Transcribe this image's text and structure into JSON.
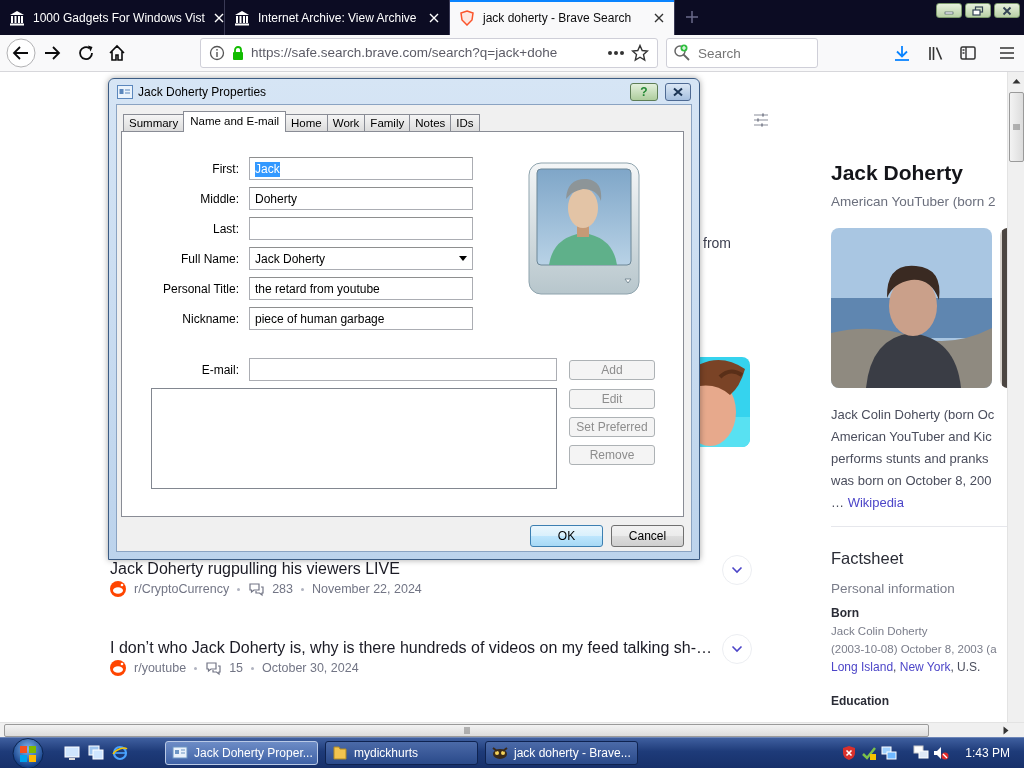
{
  "browser": {
    "tabs": [
      {
        "title": "1000 Gadgets For Windows Vist",
        "kind": "archive",
        "selected": false
      },
      {
        "title": "Internet Archive: View Archive",
        "kind": "archive",
        "selected": false
      },
      {
        "title": "jack doherty - Brave Search",
        "kind": "brave",
        "selected": true
      }
    ],
    "url": "https://safe.search.brave.com/search?q=jack+dohe",
    "search_placeholder": "Search"
  },
  "page": {
    "snippet_fragment": "from",
    "results": [
      {
        "title": "Jack Doherty rugpulling his viewers LIVE",
        "community": "r/CryptoCurrency",
        "comments": "283",
        "date": "November 22, 2024"
      },
      {
        "title": "I don’t who Jack Doherty is, why is there hundreds of videos on my feed talking sh-…",
        "community": "r/youtube",
        "comments": "15",
        "date": "October 30, 2024"
      }
    ],
    "infobox": {
      "title": "Jack Doherty",
      "subtitle": "American YouTuber (born 2",
      "description_lines": [
        "Jack Colin Doherty (born Oc",
        "American YouTuber and Kic",
        "performs stunts and pranks",
        "was born on October 8, 200"
      ],
      "ellipsis": "…",
      "source_link": "Wikipedia",
      "factsheet_title": "Factsheet",
      "section": "Personal information",
      "born_label": "Born",
      "born_lines": [
        "Jack Colin Doherty",
        "(2003-10-08) October 8, 2003 (a"
      ],
      "born_place": [
        {
          "text": "Long Island",
          "link": true
        },
        {
          "text": ", ",
          "link": false
        },
        {
          "text": "New York",
          "link": true
        },
        {
          "text": ", U.S.",
          "link": false
        }
      ],
      "education_label": "Education"
    }
  },
  "dialog": {
    "title": "Jack Doherty Properties",
    "help": "?",
    "tabs": [
      {
        "label": "Summary",
        "selected": false
      },
      {
        "label": "Name and E-mail",
        "selected": true
      },
      {
        "label": "Home",
        "selected": false
      },
      {
        "label": "Work",
        "selected": false
      },
      {
        "label": "Family",
        "selected": false
      },
      {
        "label": "Notes",
        "selected": false
      },
      {
        "label": "IDs",
        "selected": false
      }
    ],
    "fields": [
      {
        "label": "First:",
        "value": "Jack",
        "kind": "text",
        "highlighted": true
      },
      {
        "label": "Middle:",
        "value": "Doherty",
        "kind": "text",
        "highlighted": false
      },
      {
        "label": "Last:",
        "kind": "text",
        "highlighted": false
      },
      {
        "label": "Full Name:",
        "value": "Jack Doherty",
        "kind": "dropdown",
        "highlighted": false
      },
      {
        "label": "Personal Title:",
        "value": "the retard from youtube",
        "kind": "text",
        "highlighted": false
      },
      {
        "label": "Nickname:",
        "value": "piece of human garbage",
        "kind": "text",
        "highlighted": false
      }
    ],
    "email_label": "E-mail:",
    "email_buttons": [
      {
        "label": "Add",
        "disabled": true
      },
      {
        "label": "Edit",
        "disabled": true
      },
      {
        "label": "Set Preferred",
        "disabled": true
      },
      {
        "label": "Remove",
        "disabled": true
      }
    ],
    "buttons": [
      {
        "label": "OK",
        "default": true
      },
      {
        "label": "Cancel",
        "default": false
      }
    ]
  },
  "taskbar": {
    "tasks": [
      {
        "title": "Jack Doherty Proper...",
        "kind": "contact",
        "selected": true
      },
      {
        "title": "mydickhurts",
        "kind": "folder",
        "selected": false
      },
      {
        "title": "jack doherty - Brave...",
        "kind": "browser",
        "selected": false
      }
    ],
    "clock": "1:43 PM"
  }
}
